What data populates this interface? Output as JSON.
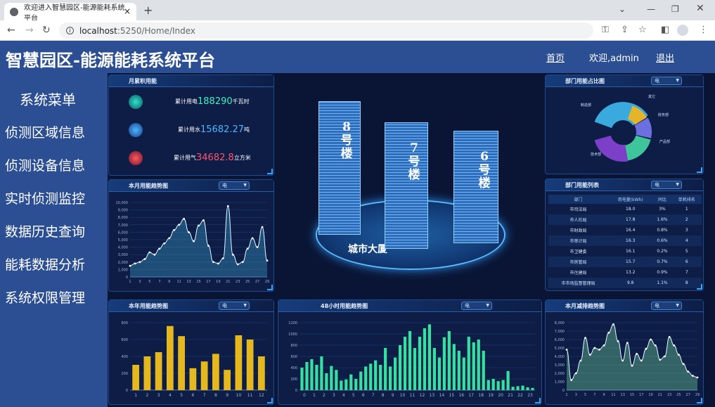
{
  "browser": {
    "tab_title": "欢迎进入智慧园区-能源能耗系统平台",
    "url_host": "localhost",
    "url_rest": ":5250/Home/Index",
    "close_glyph": "×",
    "new_tab_glyph": "+"
  },
  "header": {
    "title": "智慧园区-能源能耗系统平台",
    "home_link": "首页",
    "welcome": "欢迎,admin",
    "logout_link": "退出"
  },
  "sidebar": {
    "title": "系统菜单",
    "items": [
      {
        "label": "侦测区域信息"
      },
      {
        "label": "侦测设备信息"
      },
      {
        "label": "实时侦测监控"
      },
      {
        "label": "数据历史查询"
      },
      {
        "label": "能耗数据分析"
      },
      {
        "label": "系统权限管理"
      }
    ]
  },
  "monthly_total": {
    "title": "月累积用能",
    "electric": {
      "label": "累计用电",
      "value": "188290",
      "unit": "千瓦时",
      "color": "#3df0c4"
    },
    "water": {
      "label": "累计用水",
      "value": "15682.27",
      "unit": "吨",
      "color": "#4fb6ff"
    },
    "gas": {
      "label": "累计用气",
      "value": "34682.8",
      "unit": "立方米",
      "color": "#ff5470"
    }
  },
  "center": {
    "tower_labels": [
      "8号楼",
      "7号楼",
      "6号楼"
    ],
    "base_label": "城市大厦"
  },
  "select_default": "电",
  "dept_share": {
    "title": "部门用能占比图",
    "labels": [
      "制造部",
      "其它",
      "财务部",
      "产品部",
      "技术部"
    ]
  },
  "dept_table": {
    "title": "部门用能列表",
    "headers": [
      "部门",
      "用电量(kWh)",
      "同比",
      "单耗排名"
    ],
    "rows": [
      [
        "市司法局",
        "18.0",
        "3%",
        "1"
      ],
      [
        "市人社局",
        "17.8",
        "1.6%",
        "2"
      ],
      [
        "市财政局",
        "16.4",
        "0.8%",
        "3"
      ],
      [
        "市审计局",
        "16.3",
        "0.6%",
        "4"
      ],
      [
        "市卫健委",
        "16.1",
        "0.2%",
        "5"
      ],
      [
        "市房管局",
        "15.7",
        "0.7%",
        "6"
      ],
      [
        "市住建局",
        "13.2",
        "0.9%",
        "7"
      ],
      [
        "市市场监督管理局",
        "9.8",
        "1.1%",
        "8"
      ]
    ]
  },
  "chart_data": [
    {
      "type": "area",
      "title": "本月用能趋势图",
      "x": [
        1,
        2,
        3,
        4,
        5,
        6,
        7,
        8,
        9,
        10,
        11,
        12,
        13,
        14,
        15,
        16,
        17,
        18,
        19,
        20,
        21,
        22,
        23,
        24,
        25,
        26,
        27,
        28,
        29
      ],
      "x_ticks": [
        "1",
        "3",
        "5",
        "7",
        "9",
        "11",
        "13",
        "15",
        "17",
        "19",
        "21",
        "23",
        "25",
        "27",
        "29"
      ],
      "y_ticks": [
        "0",
        "1,000",
        "2,000",
        "3,000",
        "4,000",
        "5,000",
        "6,000",
        "7,000",
        "8,000",
        "9,000",
        "10,000"
      ],
      "values": [
        1500,
        1800,
        2000,
        2400,
        3300,
        3000,
        3800,
        4500,
        5200,
        6300,
        7000,
        7800,
        6000,
        4800,
        6900,
        7600,
        4200,
        2000,
        1800,
        2500,
        9500,
        3000,
        1700,
        2000,
        3800,
        5200,
        4000,
        6700,
        2200
      ],
      "ylim": [
        0,
        10000
      ],
      "color": "#3fa9d8"
    },
    {
      "type": "bar",
      "title": "本年用能趋势图",
      "categories": [
        "1",
        "2",
        "3",
        "4",
        "5",
        "6",
        "7",
        "8",
        "9",
        "10",
        "11",
        "12"
      ],
      "y_ticks": [
        "0",
        "200",
        "400",
        "600",
        "800"
      ],
      "values": [
        300,
        400,
        450,
        760,
        640,
        260,
        340,
        430,
        240,
        650,
        600,
        400
      ],
      "ylim": [
        0,
        800
      ],
      "color": "#e5b81f"
    },
    {
      "type": "bar",
      "title": "48小时用能趋势图",
      "categories": [
        "0",
        "1",
        "2",
        "3",
        "4",
        "5",
        "6",
        "7",
        "8",
        "9",
        "10",
        "11",
        "12",
        "13",
        "14",
        "15",
        "16",
        "17",
        "18",
        "19",
        "20",
        "21",
        "22",
        "23"
      ],
      "y_ticks": [
        "0",
        "200",
        "400",
        "600",
        "800",
        "1000",
        "1200"
      ],
      "values": [
        400,
        500,
        550,
        450,
        600,
        300,
        430,
        360,
        170,
        190,
        280,
        200,
        330,
        420,
        470,
        530,
        450,
        750,
        420,
        580,
        800,
        950,
        1050,
        750,
        950,
        1100,
        1170,
        750,
        580,
        940,
        1050,
        820,
        700,
        580,
        950,
        850,
        900,
        700,
        180,
        200,
        160,
        180,
        340,
        60,
        70,
        80,
        50,
        40
      ],
      "ylim": [
        0,
        1200
      ],
      "color": "#36e0a0"
    },
    {
      "type": "area",
      "title": "本月减排趋势图",
      "x": [
        1,
        2,
        3,
        4,
        5,
        6,
        7,
        8,
        9,
        10,
        11,
        12,
        13,
        14,
        15,
        16,
        17,
        18,
        19,
        20,
        21,
        22,
        23,
        24,
        25,
        26,
        27,
        28,
        29
      ],
      "x_ticks": [
        "1",
        "3",
        "5",
        "7",
        "9",
        "11",
        "13",
        "15",
        "17",
        "19",
        "21",
        "23",
        "25",
        "27",
        "29"
      ],
      "y_ticks": [
        "0",
        "1,000",
        "2,000",
        "3,000",
        "4,000",
        "5,000",
        "6,000",
        "7,000",
        "8,000"
      ],
      "values": [
        4800,
        1200,
        2000,
        3500,
        6200,
        4200,
        5000,
        4800,
        5300,
        6800,
        7800,
        5800,
        3500,
        5600,
        2900,
        4300,
        3500,
        4900,
        6000,
        5300,
        3600,
        4000,
        6300,
        5300,
        4200,
        3100,
        2200,
        1700,
        1500
      ],
      "ylim": [
        0,
        8000
      ],
      "color": "#7ee8a0"
    }
  ]
}
